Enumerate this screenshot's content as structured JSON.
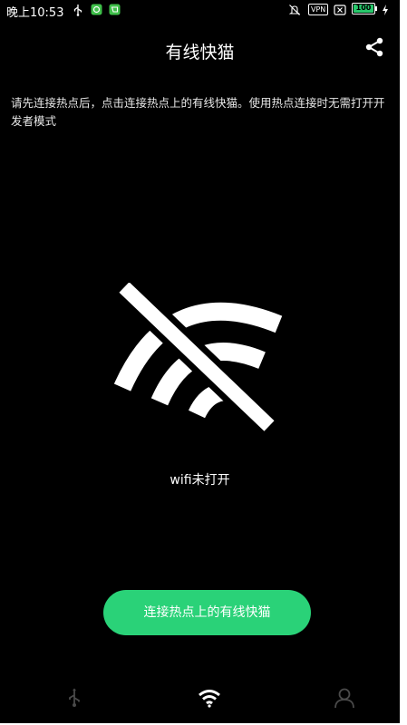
{
  "status_bar": {
    "time": "晚上10:53",
    "vpn_badge": "VPN",
    "battery_level": "100",
    "icons": [
      "usb-icon",
      "app-notification-icon",
      "app-notification-icon",
      "mute-icon",
      "sim-off-icon",
      "charging-icon"
    ]
  },
  "header": {
    "title": "有线快猫",
    "share_icon": "share-icon"
  },
  "hint": "请先连接热点后，点击连接热点上的有线快猫。使用热点连接时无需打开开发者模式",
  "main": {
    "wifi_icon": "wifi-off-icon",
    "wifi_status": "wifi未打开"
  },
  "connect_button": {
    "label": "连接热点上的有线快猫",
    "color": "#2ad278"
  },
  "bottom_nav": {
    "items": [
      {
        "icon": "usb-icon",
        "active": false
      },
      {
        "icon": "wifi-icon",
        "active": true
      },
      {
        "icon": "user-icon",
        "active": false
      }
    ]
  }
}
